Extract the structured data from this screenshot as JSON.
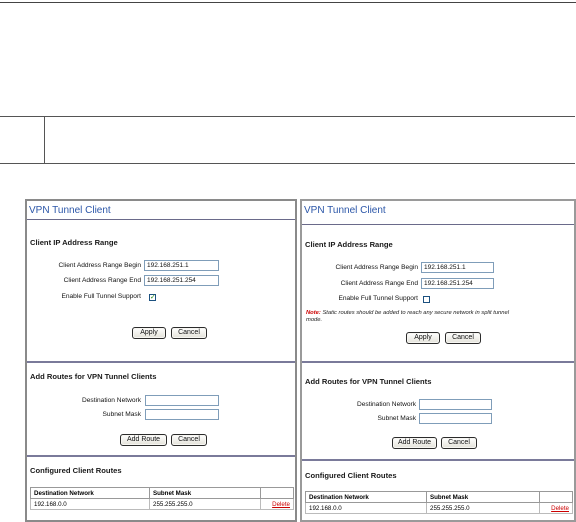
{
  "panels": [
    {
      "title": "VPN Tunnel Client",
      "client_ip": {
        "heading": "Client IP Address Range",
        "begin_label": "Client Address Range Begin",
        "begin_value": "192.168.251.1",
        "end_label": "Client Address Range End",
        "end_value": "192.168.251.254",
        "full_tunnel_label": "Enable Full Tunnel Support",
        "full_tunnel_checked": true,
        "apply": "Apply",
        "cancel": "Cancel"
      },
      "routes": {
        "heading": "Add Routes for VPN Tunnel Clients",
        "dest_label": "Destination Network",
        "mask_label": "Subnet Mask",
        "add": "Add Route",
        "cancel": "Cancel"
      },
      "configured": {
        "heading": "Configured Client Routes",
        "col_dest": "Destination Network",
        "col_mask": "Subnet Mask",
        "row": {
          "dest": "192.168.0.0",
          "mask": "255.255.255.0",
          "delete": "Delete"
        }
      }
    },
    {
      "title": "VPN Tunnel Client",
      "client_ip": {
        "heading": "Client IP Address Range",
        "begin_label": "Client Address Range Begin",
        "begin_value": "192.168.251.1",
        "end_label": "Client Address Range End",
        "end_value": "192.168.251.254",
        "full_tunnel_label": "Enable Full Tunnel Support",
        "full_tunnel_checked": false,
        "note_prefix": "Note:",
        "note_text": "Static routes should be added to reach any secure network in split tunnel mode.",
        "apply": "Apply",
        "cancel": "Cancel"
      },
      "routes": {
        "heading": "Add Routes for VPN Tunnel Clients",
        "dest_label": "Destination Network",
        "mask_label": "Subnet Mask",
        "add": "Add Route",
        "cancel": "Cancel"
      },
      "configured": {
        "heading": "Configured Client Routes",
        "col_dest": "Destination Network",
        "col_mask": "Subnet Mask",
        "row": {
          "dest": "192.168.0.0",
          "mask": "255.255.255.0",
          "delete": "Delete"
        }
      }
    }
  ]
}
